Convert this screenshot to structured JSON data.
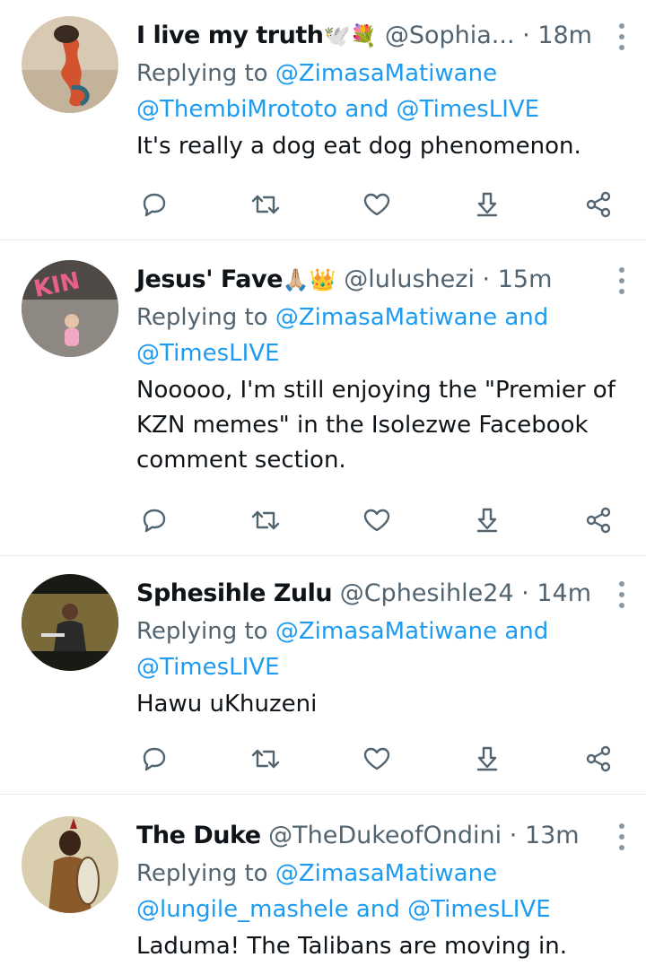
{
  "tweets": [
    {
      "name": "I live my truth",
      "emoji": "🕊️💐",
      "handle": "@Sophia...",
      "dot": "·",
      "time": "18m",
      "reply_prefix": "Replying to",
      "reply_mentions_line1": "@ZimasaMatiwane",
      "reply_mentions_line2": "@ThembiMrototo",
      "reply_and": "and",
      "reply_mentions_line2b": "@TimesLIVE",
      "text": "It's really a dog eat dog phenomenon."
    },
    {
      "name": "Jesus' Fave",
      "emoji": "🙏🏼👑",
      "handle": "@lulushezi",
      "dot": "·",
      "time": "15m",
      "reply_prefix": "Replying to",
      "reply_mentions_line1": "@ZimasaMatiwane",
      "reply_and": "and",
      "reply_mentions_line2": "@TimesLIVE",
      "text": "Nooooo, I'm still enjoying the \"Premier of KZN memes\" in the Isolezwe Facebook comment section."
    },
    {
      "name": "Sphesihle Zulu",
      "handle": "@Cphesihle24",
      "dot": "·",
      "time": "14m",
      "reply_prefix": "Replying to",
      "reply_mentions_line1": "@ZimasaMatiwane",
      "reply_and": "and",
      "reply_mentions_line2": "@TimesLIVE",
      "text": "Hawu uKhuzeni"
    },
    {
      "name": "The Duke",
      "handle": "@TheDukeofOndini",
      "dot": "·",
      "time": "13m",
      "reply_prefix": "Replying to",
      "reply_mentions_line1": "@ZimasaMatiwane",
      "reply_mentions_line2": "@lungile_mashele",
      "reply_and": "and",
      "reply_mentions_line2b": "@TimesLIVE",
      "text": "Laduma! The Talibans are moving in."
    }
  ],
  "icons": [
    "reply-icon",
    "retweet-icon",
    "like-icon",
    "download-icon",
    "share-icon",
    "more-icon"
  ],
  "colors": {
    "link": "#1d9bf0",
    "secondary": "#536471",
    "text": "#0f1419",
    "divider": "#e6ecf0"
  }
}
